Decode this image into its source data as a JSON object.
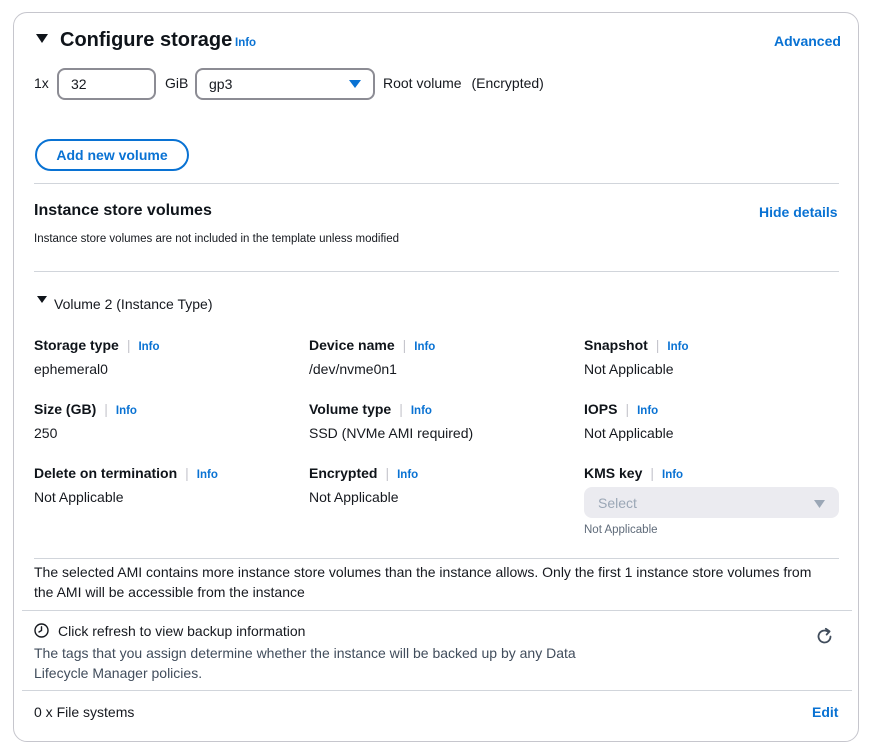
{
  "header": {
    "title": "Configure storage",
    "info": "Info",
    "advanced": "Advanced"
  },
  "root_volume": {
    "count": "1x",
    "size_value": "32",
    "unit": "GiB",
    "volume_type": "gp3",
    "label": "Root volume",
    "encrypted": "(Encrypted)"
  },
  "add_volume_button": "Add new volume",
  "instance_store": {
    "title": "Instance store volumes",
    "hide_details": "Hide details",
    "description": "Instance store volumes are not included in the template unless modified",
    "volume_title": "Volume 2 (Instance Type)",
    "fields": {
      "storage_type": {
        "label": "Storage type",
        "info": "Info",
        "value": "ephemeral0"
      },
      "device_name": {
        "label": "Device name",
        "info": "Info",
        "value": "/dev/nvme0n1"
      },
      "snapshot": {
        "label": "Snapshot",
        "info": "Info",
        "value": "Not Applicable"
      },
      "size": {
        "label": "Size (GB)",
        "info": "Info",
        "value": "250"
      },
      "volume_type": {
        "label": "Volume type",
        "info": "Info",
        "value": "SSD (NVMe AMI required)"
      },
      "iops": {
        "label": "IOPS",
        "info": "Info",
        "value": "Not Applicable"
      },
      "delete_on_termination": {
        "label": "Delete on termination",
        "info": "Info",
        "value": "Not Applicable"
      },
      "encrypted": {
        "label": "Encrypted",
        "info": "Info",
        "value": "Not Applicable"
      },
      "kms_key": {
        "label": "KMS key",
        "info": "Info",
        "placeholder": "Select",
        "hint": "Not Applicable"
      }
    },
    "warning_line1": "The selected AMI contains more instance store volumes than the instance allows. Only the first 1 instance store volumes from",
    "warning_line2": "the AMI will be accessible from the instance"
  },
  "backup": {
    "title": "Click refresh to view backup information",
    "desc_line1": "The tags that you assign determine whether the instance will be backed up by any Data",
    "desc_line2": "Lifecycle Manager policies."
  },
  "file_systems": {
    "label": "0 x File systems",
    "edit": "Edit"
  },
  "icons": {
    "collapse": "caret-down-icon",
    "clock": "clock-icon",
    "refresh": "refresh-icon",
    "dropdown": "dropdown-caret-icon"
  },
  "colors": {
    "link": "#0972d3",
    "border": "#c6c6cd",
    "text": "#16191f"
  }
}
